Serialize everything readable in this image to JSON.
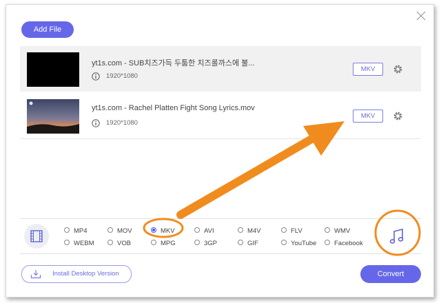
{
  "header": {
    "add_file_label": "Add File"
  },
  "files": [
    {
      "name": "yt1s.com - SUB치즈가득 두툼한 치즈롤까스에 불...",
      "resolution": "1920*1080",
      "format": "MKV"
    },
    {
      "name": "yt1s.com - Rachel Platten Fight Song Lyrics.mov",
      "resolution": "1920*1080",
      "format": "MKV"
    }
  ],
  "formats": {
    "row1": [
      "MP4",
      "MOV",
      "MKV",
      "AVI",
      "M4V",
      "FLV",
      "WMV"
    ],
    "row2": [
      "WEBM",
      "VOB",
      "MPG",
      "3GP",
      "GIF",
      "YouTube",
      "Facebook"
    ],
    "selected": "MKV"
  },
  "footer": {
    "install_label": "Install Desktop Version",
    "convert_label": "Convert"
  },
  "colors": {
    "accent": "#6667e8",
    "annotation": "#f08c1e"
  },
  "icons": [
    "close-icon",
    "info-icon",
    "gear-icon",
    "film-icon",
    "music-note-icon",
    "download-icon"
  ]
}
